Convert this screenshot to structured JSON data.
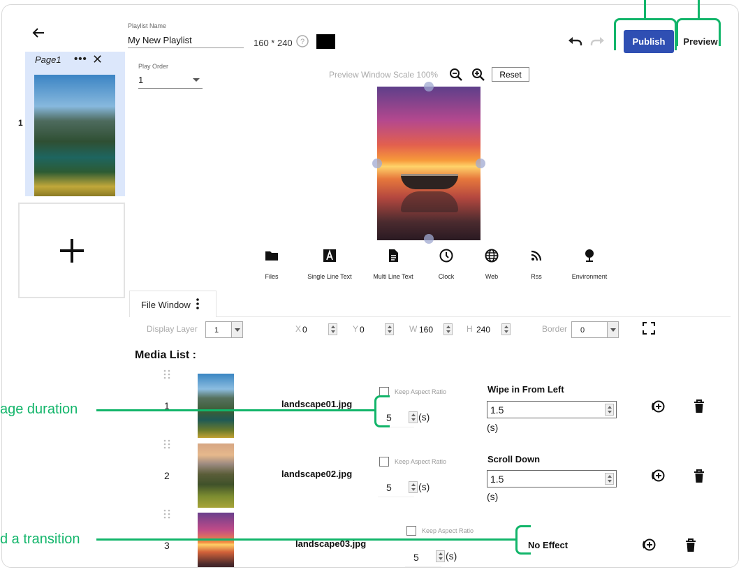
{
  "header": {
    "playlist_name_label": "Playlist Name",
    "playlist_name_value": "My New Playlist",
    "resolution": "160 * 240",
    "publish_label": "Publish",
    "preview_label": "Preview"
  },
  "pages": [
    {
      "number": "1",
      "label": "Page1",
      "more": "•••"
    }
  ],
  "play_order": {
    "label": "Play Order",
    "value": "1"
  },
  "preview": {
    "scale_label": "Preview Window Scale",
    "scale_value": "100%",
    "reset_label": "Reset"
  },
  "toolbar": {
    "items": [
      {
        "label": "Files",
        "icon": "folder-icon"
      },
      {
        "label": "Single Line Text",
        "icon": "text-a-icon"
      },
      {
        "label": "Multi Line Text",
        "icon": "document-icon"
      },
      {
        "label": "Clock",
        "icon": "clock-icon"
      },
      {
        "label": "Web",
        "icon": "globe-icon"
      },
      {
        "label": "Rss",
        "icon": "rss-icon"
      },
      {
        "label": "Environment",
        "icon": "location-pin-icon"
      }
    ]
  },
  "window_tab": {
    "label": "File Window"
  },
  "properties": {
    "display_layer_label": "Display Layer",
    "display_layer_value": "1",
    "x_label": "X",
    "x_value": "0",
    "y_label": "Y",
    "y_value": "0",
    "w_label": "W",
    "w_value": "160",
    "h_label": "H",
    "h_value": "240",
    "border_label": "Border",
    "border_value": "0"
  },
  "media_list": {
    "title": "Media List :",
    "keep_aspect_label": "Keep Aspect Ratio",
    "unit": "(s)",
    "items": [
      {
        "index": "1",
        "filename": "landscape01.jpg",
        "duration": "5",
        "transition": "Wipe in From Left",
        "transition_duration": "1.5"
      },
      {
        "index": "2",
        "filename": "landscape02.jpg",
        "duration": "5",
        "transition": "Scroll Down",
        "transition_duration": "1.5"
      },
      {
        "index": "3",
        "filename": "landscape03.jpg",
        "duration": "5",
        "transition": "No Effect",
        "transition_duration": ""
      }
    ]
  },
  "annotations": {
    "image_duration": "age duration",
    "add_transition": "d a transition"
  },
  "colors": {
    "publish_bg": "#2f4fb3",
    "annotation_green": "#12b56a",
    "page_selected_bg": "#dce7fb",
    "background_color_swatch": "#000000"
  }
}
